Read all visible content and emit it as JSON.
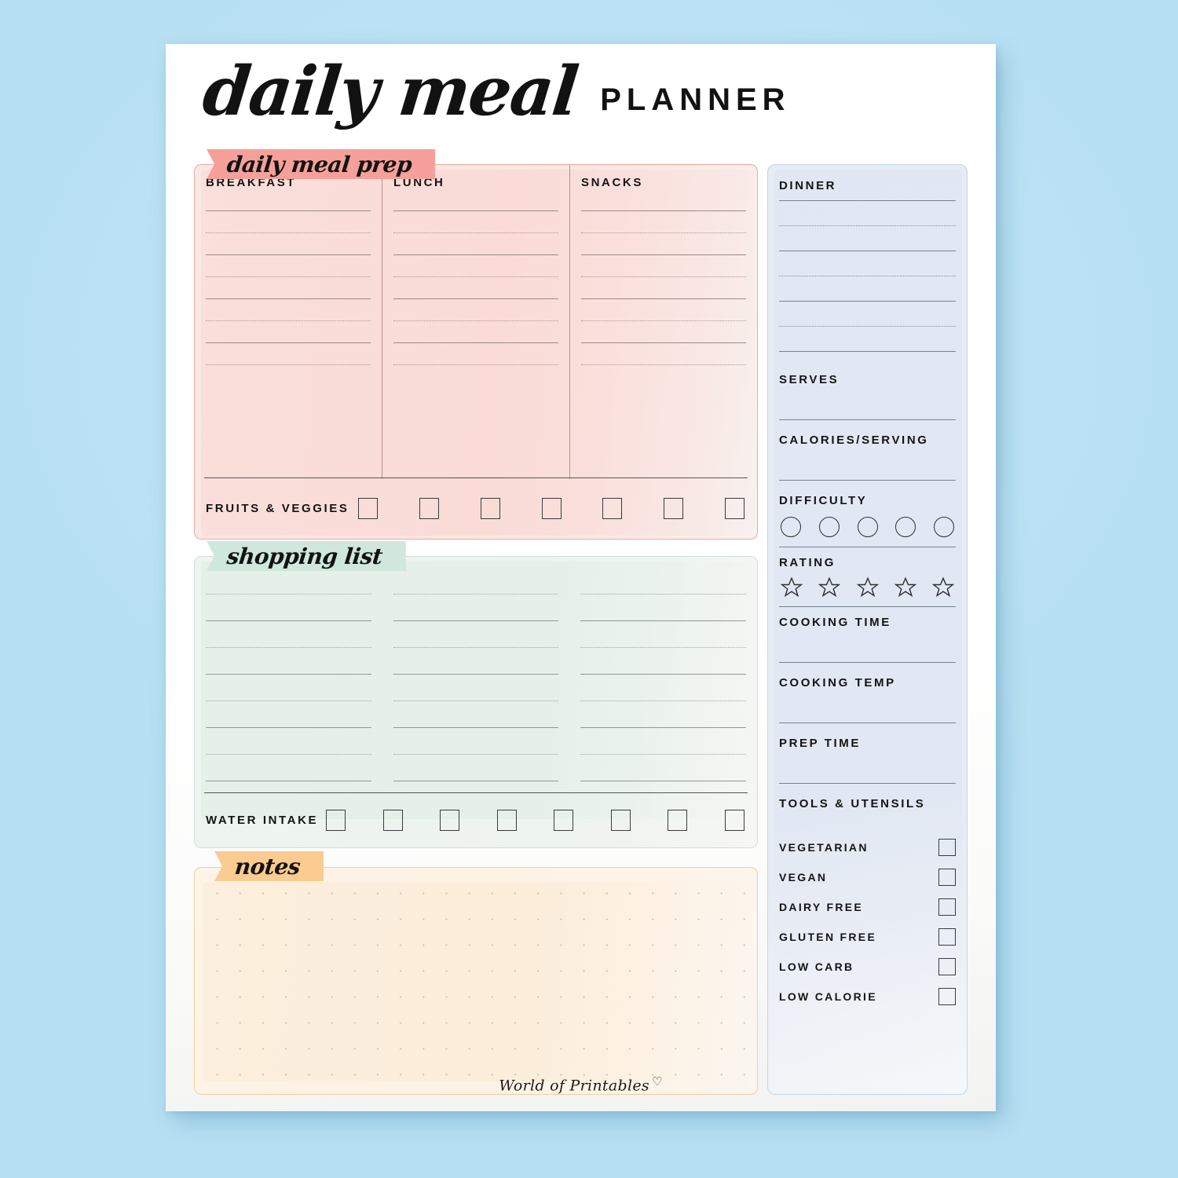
{
  "page": {
    "title_script": "daily meal",
    "title_sans": "PLANNER",
    "footer_brand": "World of Printables",
    "footer_heart": "♡",
    "background_color": "#bfe4f5",
    "paper_color": "#ffffff"
  },
  "meal_prep": {
    "banner": "daily meal prep",
    "banner_color": "#f5a09a",
    "panel_border_color": "#f0a99f",
    "panel_fill_color": "#fae8e5",
    "columns": [
      {
        "label": "BREAKFAST",
        "line_count": 8
      },
      {
        "label": "LUNCH",
        "line_count": 8
      },
      {
        "label": "SNACKS",
        "line_count": 8
      }
    ],
    "tracker": {
      "label": "FRUITS & VEGGIES",
      "checkbox_count": 7
    }
  },
  "shopping_list": {
    "banner": "shopping list",
    "banner_color": "#cfe7dd",
    "panel_border_color": "#cfe0d8",
    "panel_fill_color": "#eef4ef",
    "columns": [
      {
        "line_count": 8
      },
      {
        "line_count": 8
      },
      {
        "line_count": 8
      }
    ],
    "tracker": {
      "label": "WATER INTAKE",
      "checkbox_count": 8
    }
  },
  "notes": {
    "banner": "notes",
    "banner_color": "#fbcb91",
    "panel_border_color": "#f3ce9e",
    "panel_fill_color": "#fdf3e6",
    "grid_style": "dot-grid"
  },
  "sidebar": {
    "panel_border_color": "#c3d7ea",
    "panel_fill_color": "#e6ebf4",
    "dinner": {
      "label": "DINNER",
      "line_count": 7
    },
    "fields": [
      {
        "label": "SERVES",
        "type": "write-in"
      },
      {
        "label": "CALORIES/SERVING",
        "type": "write-in"
      }
    ],
    "difficulty": {
      "label": "DIFFICULTY",
      "icon": "circle-icon",
      "count": 5
    },
    "rating": {
      "label": "RATING",
      "icon": "star-icon",
      "count": 5
    },
    "fields_2": [
      {
        "label": "COOKING TIME",
        "type": "write-in"
      },
      {
        "label": "COOKING TEMP",
        "type": "write-in"
      },
      {
        "label": "PREP TIME",
        "type": "write-in"
      },
      {
        "label": "TOOLS & UTENSILS",
        "type": "write-in"
      }
    ],
    "dietary": [
      {
        "label": "VEGETARIAN",
        "checked": false
      },
      {
        "label": "VEGAN",
        "checked": false
      },
      {
        "label": "DAIRY FREE",
        "checked": false
      },
      {
        "label": "GLUTEN FREE",
        "checked": false
      },
      {
        "label": "LOW CARB",
        "checked": false
      },
      {
        "label": "LOW CALORIE",
        "checked": false
      }
    ]
  }
}
